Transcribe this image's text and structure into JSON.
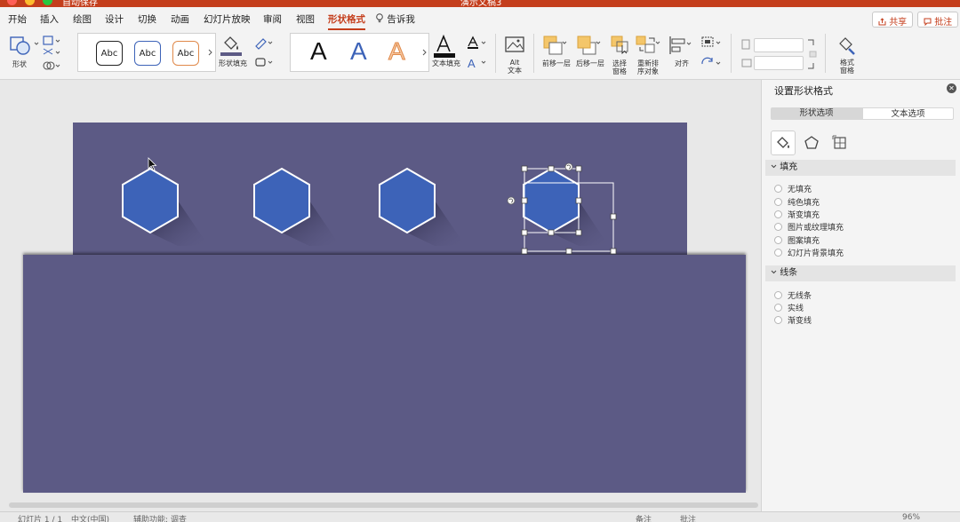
{
  "titlebar": {
    "autosave": "自动保存",
    "doc_title": "演示文稿3"
  },
  "menu": {
    "tabs": [
      "开始",
      "插入",
      "绘图",
      "设计",
      "切换",
      "动画",
      "幻灯片放映",
      "审阅",
      "视图",
      "形状格式",
      "告诉我"
    ],
    "active_tab": "形状格式",
    "share": "共享",
    "comment": "批注"
  },
  "ribbon": {
    "shape": "形状",
    "style_preview": "Abc",
    "shape_fill": "形状填充",
    "text_fill": "文本填充",
    "wordart": "A",
    "alt_text": "Alt 文本",
    "bring_forward": "前移一层",
    "send_backward": "后移一层",
    "selection_pane": "选择 窗格",
    "reorder": "重新排 序对象",
    "align": "对齐",
    "format_pane": "格式 窗格"
  },
  "pane": {
    "title": "设置形状格式",
    "tabs": [
      "形状选项",
      "文本选项"
    ],
    "fill_header": "填充",
    "fill_options": [
      "无填充",
      "纯色填充",
      "渐变填充",
      "图片或纹理填充",
      "图案填充",
      "幻灯片背景填充"
    ],
    "line_header": "线条",
    "line_options": [
      "无线条",
      "实线",
      "渐变线"
    ]
  },
  "statusbar": {
    "slide_info": "幻灯片 1 / 1",
    "language": "中文(中国)",
    "accessibility": "辅助功能: 调查",
    "notes": "备注",
    "comments": "批注",
    "zoom": "96%"
  },
  "colors": {
    "accent": "#c43e1c",
    "slide_bg": "#5c5a85",
    "hexagon_fill": "#3d63b8"
  }
}
